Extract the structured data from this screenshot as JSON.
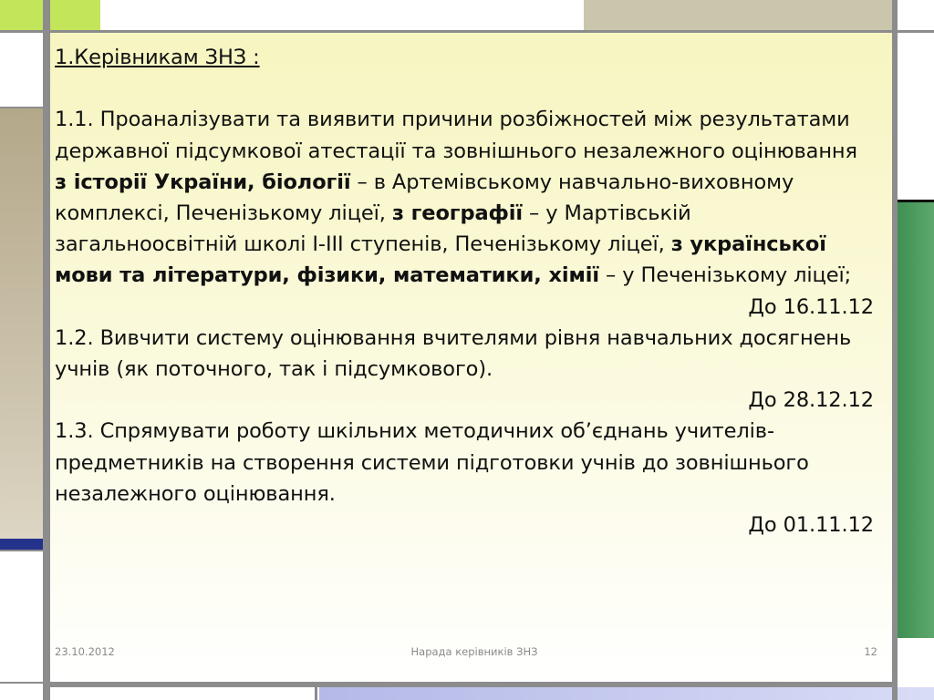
{
  "heading": "1.Керівникам ЗНЗ :",
  "item1": {
    "t1": "1.1. Проаналізувати та виявити причини розбіжностей між результатами державної підсумкової атестації та зовнішнього незалежного оцінювання ",
    "b1": "з історії України, біології",
    "t2": " – в Артемівському навчально-виховному комплексі, Печенізькому ліцеї, ",
    "b2": "з географії",
    "t3": " – у Мартівській загальноосвітній школі І-ІІІ ступенів, Печенізькому ліцеї, ",
    "b3": "з української мови та літератури, фізики, математики, хімії",
    "t4": " – у Печенізькому ліцеї;",
    "deadline": "До 16.11.12"
  },
  "item2": {
    "text": "1.2. Вивчити систему оцінювання вчителями рівня навчальних досягнень учнів (як поточного, так і підсумкового).",
    "deadline": "До 28.12.12"
  },
  "item3": {
    "text": "1.3. Спрямувати роботу шкільних методичних об’єднань учителів-предметників на створення системи підготовки учнів до зовнішнього незалежного оцінювання.",
    "deadline": "До 01.11.12"
  },
  "footer": {
    "date": "23.10.2012",
    "title": "Нарада керівників ЗНЗ",
    "page": "12"
  },
  "colors": {
    "green": "#c3e55a",
    "khaki": "#c9c6ad",
    "tan": "#b5a98c",
    "navy": "#24328c",
    "dark_green": "#4e9b60",
    "gray_line": "#8c8c8c"
  }
}
